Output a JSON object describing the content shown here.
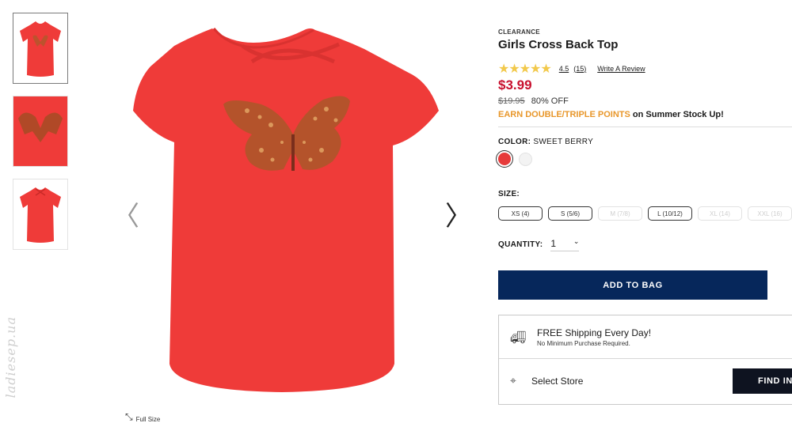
{
  "product": {
    "badge": "CLEARANCE",
    "title": "Girls Cross Back Top",
    "rating_value": "4.5",
    "review_count": "(15)",
    "write_review": "Write A Review",
    "stars": "★★★★★",
    "price": "$3.99",
    "old_price": "$19.95",
    "discount": "80% OFF",
    "points_highlight": "EARN DOUBLE/TRIPLE POINTS",
    "points_rest": " on Summer Stock Up!"
  },
  "color": {
    "label": "COLOR:",
    "value": "SWEET BERRY",
    "swatches": [
      "#e63a3a",
      "#f3f3f3"
    ]
  },
  "size": {
    "label": "SIZE:",
    "options": [
      "XS (4)",
      "S (5/6)",
      "M (7/8)",
      "L (10/12)",
      "XL (14)",
      "XXL (16)"
    ]
  },
  "quantity": {
    "label": "QUANTITY:",
    "value": "1"
  },
  "buttons": {
    "add_to_bag": "ADD TO BAG",
    "find": "FIND IN"
  },
  "shipping": {
    "title": "FREE Shipping Every Day!",
    "subtitle": "No Minimum Purchase Required."
  },
  "store": {
    "label": "Select Store"
  },
  "gallery": {
    "full_size": "Full Size",
    "watermark": "ladiesep.ua"
  },
  "colors": {
    "price_red": "#c8102e",
    "points_orange": "#e8972b",
    "button_navy": "#06275b",
    "shirt_red": "#ef3b39"
  }
}
